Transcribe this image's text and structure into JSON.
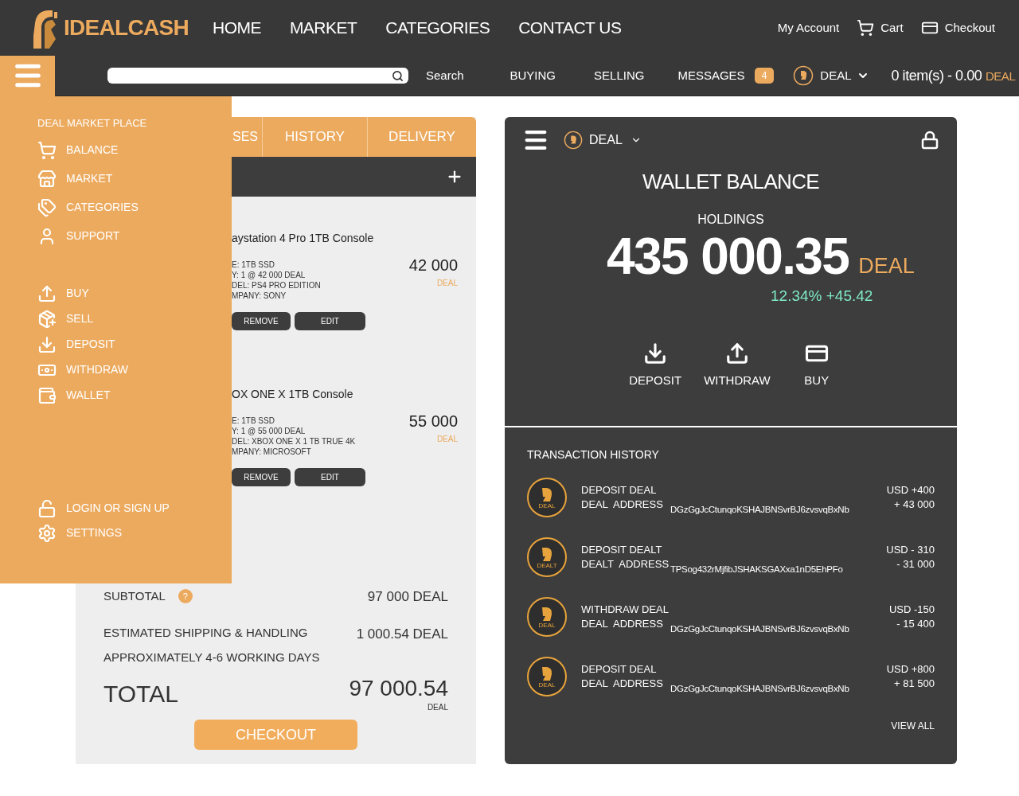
{
  "header": {
    "logo": "IDEALCASH",
    "nav": [
      "HOME",
      "MARKET",
      "CATEGORIES",
      "CONTACT US"
    ],
    "account_links": [
      {
        "kind": "account",
        "label": "My Account"
      },
      {
        "kind": "cart",
        "label": "Cart"
      },
      {
        "kind": "checkout",
        "label": "Checkout"
      }
    ]
  },
  "subbar": {
    "search_button": "Search",
    "links": [
      "BUYING",
      "SELLING"
    ],
    "messages": {
      "label": "MESSAGES",
      "count": "4"
    },
    "currency": "DEAL",
    "cart_summary": {
      "text": "0 item(s) - 0.00",
      "unit": "DEAL"
    }
  },
  "drawer": {
    "heading": "DEAL MARKET PLACE",
    "groups": [
      [
        {
          "kind": "balance",
          "label": "BALANCE"
        },
        {
          "kind": "market",
          "label": "MARKET"
        },
        {
          "kind": "categories",
          "label": "CATEGORIES"
        },
        {
          "kind": "support",
          "label": "SUPPORT"
        }
      ],
      [
        {
          "kind": "buy",
          "label": "BUY"
        },
        {
          "kind": "sell",
          "label": "SELL"
        },
        {
          "kind": "deposit",
          "label": "DEPOSIT"
        },
        {
          "kind": "withdraw",
          "label": "WITHDRAW"
        },
        {
          "kind": "wallet",
          "label": "WALLET"
        }
      ],
      [
        {
          "kind": "login",
          "label": "LOGIN OR SIGN UP"
        },
        {
          "kind": "settings",
          "label": "SETTINGS"
        }
      ]
    ]
  },
  "cart": {
    "tabs": [
      "SES",
      "HISTORY",
      "DELIVERY"
    ],
    "items": [
      {
        "title": "aystation 4 Pro 1TB Console",
        "details": [
          "E: 1TB SSD",
          "Y: 1 @ 42 000 DEAL",
          "DEL: PS4 PRO EDITION",
          "MPANY: SONY"
        ],
        "price": "42 000",
        "unit": "DEAL",
        "buttons": [
          "REMOVE",
          "EDIT"
        ]
      },
      {
        "title": "OX ONE X  1TB Console",
        "details": [
          "E: 1TB SSD",
          "Y: 1 @ 55 000 DEAL",
          "DEL: XBOX ONE X 1 TB TRUE 4K",
          "MPANY: MICROSOFT"
        ],
        "price": "55 000",
        "unit": "DEAL",
        "buttons": [
          "REMOVE",
          "EDIT"
        ]
      }
    ],
    "subtotal": {
      "label": "SUBTOTAL",
      "help": "?",
      "value": "97 000 DEAL"
    },
    "shipping": {
      "label": "ESTIMATED SHIPPING & HANDLING",
      "note": "APPROXIMATELY 4-6 WORKING DAYS",
      "value": "1 000.54 DEAL"
    },
    "total": {
      "label": "TOTAL",
      "value": "97 000.54",
      "unit": "DEAL"
    },
    "checkout": "CHECKOUT"
  },
  "wallet": {
    "currency": "DEAL",
    "title": "WALLET BALANCE",
    "holdings_label": "HOLDINGS",
    "amount": "435 000.35",
    "unit": "DEAL",
    "change": "12.34% +45.42",
    "actions": [
      {
        "kind": "deposit",
        "label": "DEPOSIT"
      },
      {
        "kind": "withdraw",
        "label": "WITHDRAW"
      },
      {
        "kind": "buy",
        "label": "BUY"
      }
    ],
    "history": {
      "title": "TRANSACTION HISTORY",
      "transactions": [
        {
          "coin_label": "DEAL",
          "type": "DEPOSIT DEAL",
          "address_label": "DEAL  ADDRESS",
          "address": "DGzGgJcCtunqoKSHAJBNSvrBJ6zvsvqBxNb",
          "usd": "USD +400",
          "amount": "+ 43 000"
        },
        {
          "coin_label": "DEALT",
          "type": "DEPOSIT DEALT",
          "address_label": "DEALT  ADDRESS",
          "address": "TPSog432rMjfibJSHAKSGAXxa1nD5EhPFo",
          "usd": "USD - 310",
          "amount": "- 31 000"
        },
        {
          "coin_label": "DEAL",
          "type": "WITHDRAW DEAL",
          "address_label": "DEAL  ADDRESS",
          "address": "DGzGgJcCtunqoKSHAJBNSvrBJ6zvsvqBxNb",
          "usd": "USD -150",
          "amount": "- 15 400"
        },
        {
          "coin_label": "DEAL",
          "type": "DEPOSIT DEAL",
          "address_label": "DEAL  ADDRESS",
          "address": "DGzGgJcCtunqoKSHAJBNSvrBJ6zvsvqBxNb",
          "usd": "USD +800",
          "amount": "+ 81 500"
        }
      ],
      "view_all": "VIEW ALL"
    }
  }
}
